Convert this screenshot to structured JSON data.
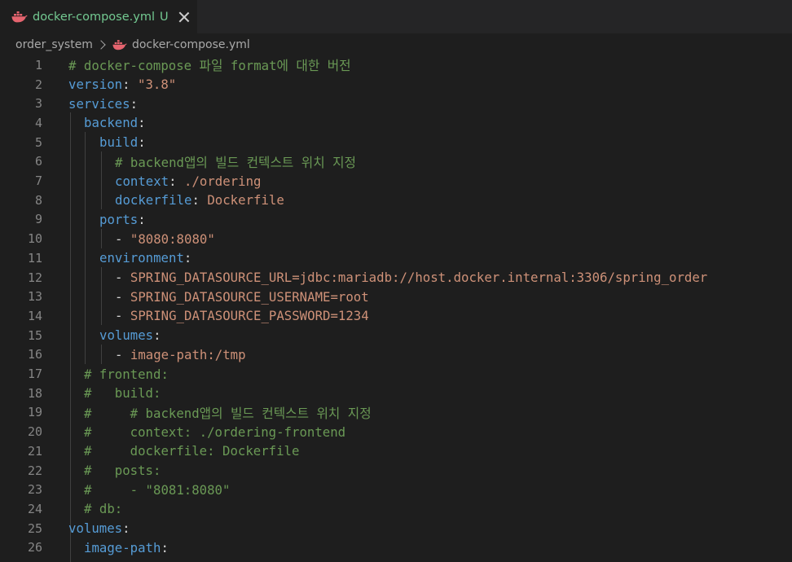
{
  "tab": {
    "title": "docker-compose.yml",
    "status": "U",
    "icon": "docker-whale-icon"
  },
  "breadcrumb": {
    "folder": "order_system",
    "file": "docker-compose.yml"
  },
  "colors": {
    "keyword": "#569cd6",
    "string": "#ce9178",
    "comment": "#6a9955",
    "punctuation": "#d4d4d4",
    "line_number": "#858585",
    "tab_modified": "#73c991",
    "docker_icon": "#e5646f"
  },
  "lines": [
    {
      "n": "1",
      "indent": "",
      "segs": [
        {
          "t": "c",
          "v": "# docker-compose 파일 format에 대한 버전"
        }
      ]
    },
    {
      "n": "2",
      "indent": "",
      "segs": [
        {
          "t": "k",
          "v": "version"
        },
        {
          "t": "p",
          "v": ": "
        },
        {
          "t": "s",
          "v": "\"3.8\""
        }
      ]
    },
    {
      "n": "3",
      "indent": "",
      "segs": [
        {
          "t": "k",
          "v": "services"
        },
        {
          "t": "p",
          "v": ":"
        }
      ]
    },
    {
      "n": "4",
      "indent": "  ",
      "segs": [
        {
          "t": "k",
          "v": "backend"
        },
        {
          "t": "p",
          "v": ":"
        }
      ]
    },
    {
      "n": "5",
      "indent": "    ",
      "segs": [
        {
          "t": "k",
          "v": "build"
        },
        {
          "t": "p",
          "v": ":"
        }
      ]
    },
    {
      "n": "6",
      "indent": "      ",
      "segs": [
        {
          "t": "c",
          "v": "# backend앱의 빌드 컨텍스트 위치 지정"
        }
      ]
    },
    {
      "n": "7",
      "indent": "      ",
      "segs": [
        {
          "t": "k",
          "v": "context"
        },
        {
          "t": "p",
          "v": ": "
        },
        {
          "t": "s",
          "v": "./ordering"
        }
      ]
    },
    {
      "n": "8",
      "indent": "      ",
      "segs": [
        {
          "t": "k",
          "v": "dockerfile"
        },
        {
          "t": "p",
          "v": ": "
        },
        {
          "t": "s",
          "v": "Dockerfile"
        }
      ]
    },
    {
      "n": "9",
      "indent": "    ",
      "segs": [
        {
          "t": "k",
          "v": "ports"
        },
        {
          "t": "p",
          "v": ":"
        }
      ]
    },
    {
      "n": "10",
      "indent": "      ",
      "segs": [
        {
          "t": "p",
          "v": "- "
        },
        {
          "t": "s",
          "v": "\"8080:8080\""
        }
      ]
    },
    {
      "n": "11",
      "indent": "    ",
      "segs": [
        {
          "t": "k",
          "v": "environment"
        },
        {
          "t": "p",
          "v": ":"
        }
      ]
    },
    {
      "n": "12",
      "indent": "      ",
      "segs": [
        {
          "t": "p",
          "v": "- "
        },
        {
          "t": "s",
          "v": "SPRING_DATASOURCE_URL=jdbc:mariadb://host.docker.internal:3306/spring_order"
        }
      ]
    },
    {
      "n": "13",
      "indent": "      ",
      "segs": [
        {
          "t": "p",
          "v": "- "
        },
        {
          "t": "s",
          "v": "SPRING_DATASOURCE_USERNAME=root"
        }
      ]
    },
    {
      "n": "14",
      "indent": "      ",
      "segs": [
        {
          "t": "p",
          "v": "- "
        },
        {
          "t": "s",
          "v": "SPRING_DATASOURCE_PASSWORD=1234"
        }
      ]
    },
    {
      "n": "15",
      "indent": "    ",
      "segs": [
        {
          "t": "k",
          "v": "volumes"
        },
        {
          "t": "p",
          "v": ":"
        }
      ]
    },
    {
      "n": "16",
      "indent": "      ",
      "segs": [
        {
          "t": "p",
          "v": "- "
        },
        {
          "t": "s",
          "v": "image-path:/tmp"
        }
      ]
    },
    {
      "n": "17",
      "indent": "  ",
      "segs": [
        {
          "t": "c",
          "v": "# frontend:"
        }
      ]
    },
    {
      "n": "18",
      "indent": "  ",
      "segs": [
        {
          "t": "c",
          "v": "#   build:"
        }
      ]
    },
    {
      "n": "19",
      "indent": "  ",
      "segs": [
        {
          "t": "c",
          "v": "#     # backend앱의 빌드 컨텍스트 위치 지정"
        }
      ]
    },
    {
      "n": "20",
      "indent": "  ",
      "segs": [
        {
          "t": "c",
          "v": "#     context: ./ordering-frontend"
        }
      ]
    },
    {
      "n": "21",
      "indent": "  ",
      "segs": [
        {
          "t": "c",
          "v": "#     dockerfile: Dockerfile"
        }
      ]
    },
    {
      "n": "22",
      "indent": "  ",
      "segs": [
        {
          "t": "c",
          "v": "#   posts:"
        }
      ]
    },
    {
      "n": "23",
      "indent": "  ",
      "segs": [
        {
          "t": "c",
          "v": "#     - \"8081:8080\""
        }
      ]
    },
    {
      "n": "24",
      "indent": "  ",
      "segs": [
        {
          "t": "c",
          "v": "# db:"
        }
      ]
    },
    {
      "n": "25",
      "indent": "",
      "segs": [
        {
          "t": "k",
          "v": "volumes"
        },
        {
          "t": "p",
          "v": ":"
        }
      ]
    },
    {
      "n": "26",
      "indent": "  ",
      "segs": [
        {
          "t": "k",
          "v": "image-path"
        },
        {
          "t": "p",
          "v": ":"
        }
      ]
    }
  ]
}
